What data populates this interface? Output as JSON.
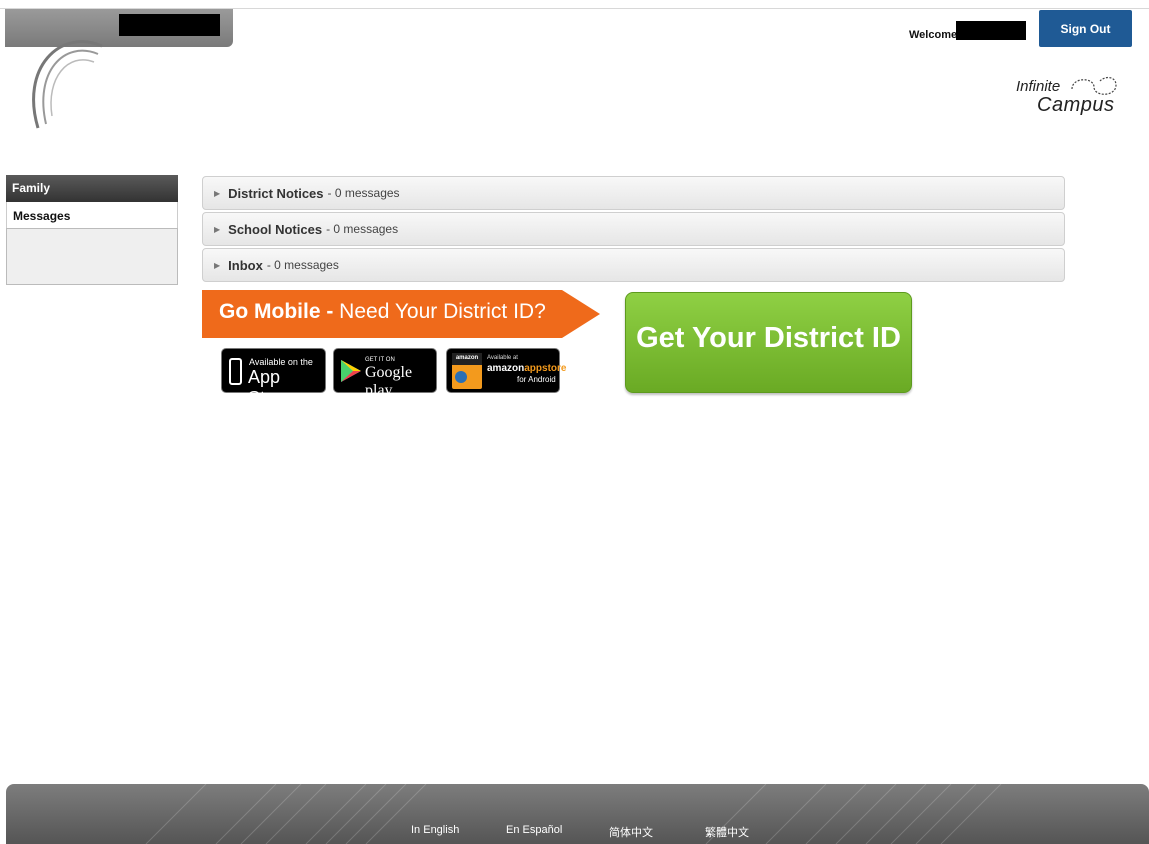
{
  "header": {
    "welcome_label": "Welcome",
    "sign_out_label": "Sign Out",
    "brand_line1": "Infinite",
    "brand_line2": "Campus"
  },
  "sidebar": {
    "section_label": "Family",
    "items": [
      {
        "label": "Messages"
      }
    ]
  },
  "notices": [
    {
      "title": "District Notices",
      "count": "- 0 messages"
    },
    {
      "title": "School Notices",
      "count": "- 0 messages"
    },
    {
      "title": "Inbox",
      "count": "- 0 messages"
    }
  ],
  "mobile_banner": {
    "strong": "Go Mobile -",
    "rest": "Need Your District ID?",
    "get_id_label": "Get Your District ID"
  },
  "badges": {
    "apple": {
      "small": "Available on the",
      "big": "App Store"
    },
    "google": {
      "small": "GET IT ON",
      "big": "Google play"
    },
    "amazon": {
      "icon_label": "amazon",
      "small": "Available at",
      "big_a": "amazon",
      "big_b": "appstore",
      "sub": "for Android"
    }
  },
  "footer": {
    "links": [
      "In English",
      "En Español",
      "简体中文",
      "繁體中文"
    ]
  },
  "colors": {
    "sign_out_bg": "#1f5a95",
    "banner_orange": "#ef6a1b",
    "get_id_green": "#7cc235",
    "footer_gray": "#6a6a6a"
  }
}
